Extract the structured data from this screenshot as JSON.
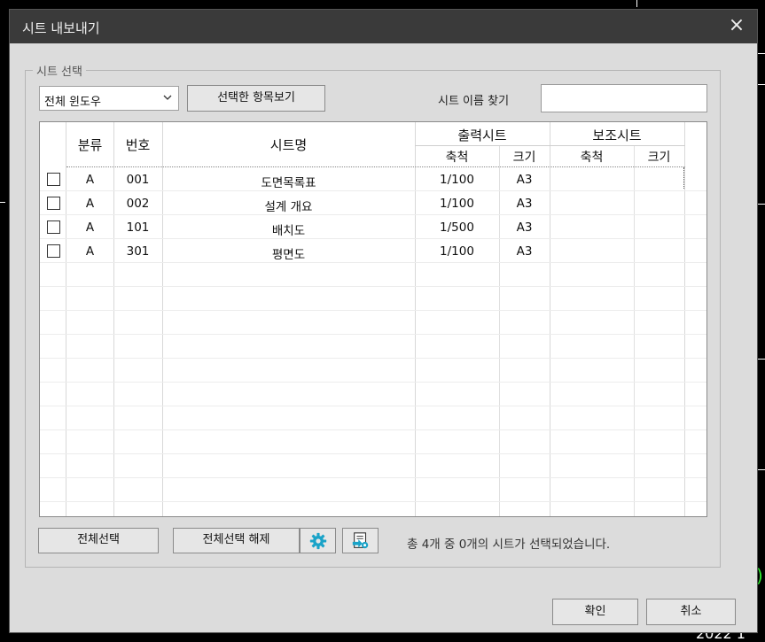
{
  "dialog": {
    "title": "시트 내보내기",
    "close_icon": "×"
  },
  "sheet_select": {
    "group_label": "시트 선택",
    "dropdown_value": "전체 윈도우",
    "view_selected_label": "선택한 항목보기",
    "search_label": "시트 이름 찾기",
    "search_value": ""
  },
  "table": {
    "headers": {
      "category": "분류",
      "number": "번호",
      "sheet_name": "시트명",
      "output_group": "출력시트",
      "sub_group": "보조시트",
      "scale": "축척",
      "size": "크기"
    },
    "rows": [
      {
        "category": "A",
        "number": "001",
        "name": "도면목록표",
        "out_scale": "1/100",
        "out_size": "A3",
        "sub_scale": "",
        "sub_size": ""
      },
      {
        "category": "A",
        "number": "002",
        "name": "설계 개요",
        "out_scale": "1/100",
        "out_size": "A3",
        "sub_scale": "",
        "sub_size": ""
      },
      {
        "category": "A",
        "number": "101",
        "name": "배치도",
        "out_scale": "1/500",
        "out_size": "A3",
        "sub_scale": "",
        "sub_size": ""
      },
      {
        "category": "A",
        "number": "301",
        "name": "평면도",
        "out_scale": "1/100",
        "out_size": "A3",
        "sub_scale": "",
        "sub_size": ""
      }
    ]
  },
  "footer": {
    "select_all_label": "전체선택",
    "deselect_all_label": "전체선택 해제",
    "status_text": "총 4개 중 0개의 시트가 선택되었습니다.",
    "ok_label": "확인",
    "cancel_label": "취소",
    "settings_icon": "gear-icon",
    "export_icon": "sheet-export-icon"
  },
  "background": {
    "date_fragment": "2022 1"
  },
  "colors": {
    "titlebar": "#3a3a3a",
    "dialog_bg": "#dcdcdc",
    "gear_accent": "#1aa3c8"
  }
}
